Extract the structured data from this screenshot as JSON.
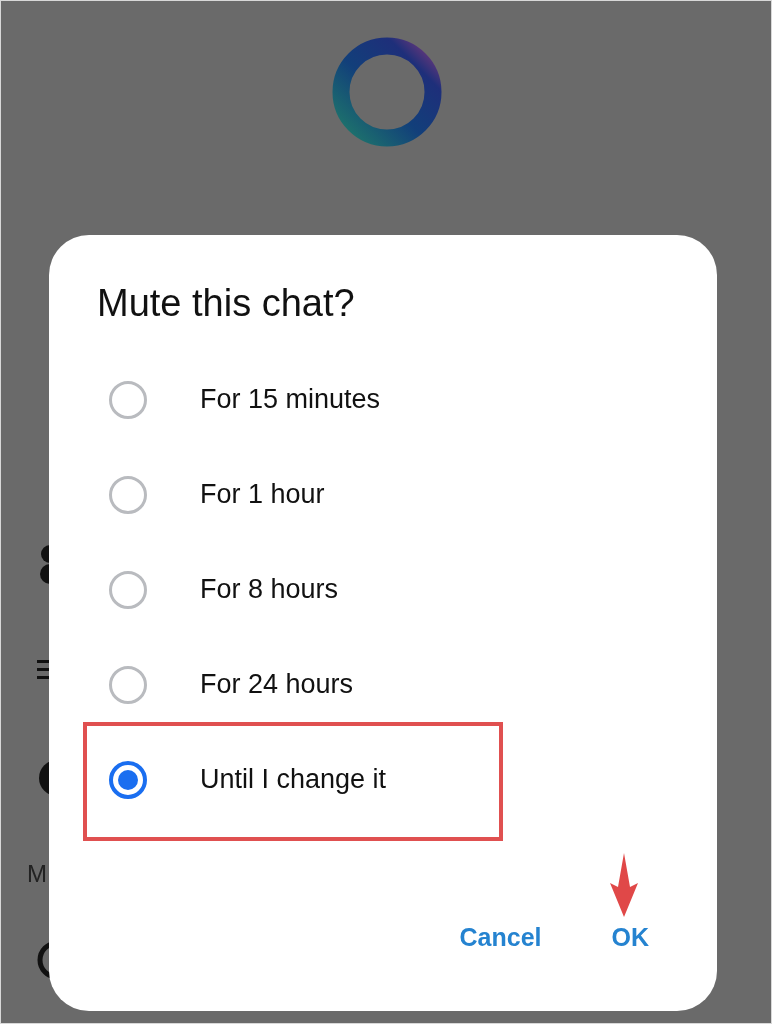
{
  "background": {
    "side_label": "M"
  },
  "dialog": {
    "title": "Mute this chat?",
    "options": [
      {
        "label": "For 15 minutes",
        "selected": false
      },
      {
        "label": "For 1 hour",
        "selected": false
      },
      {
        "label": "For 8 hours",
        "selected": false
      },
      {
        "label": "For 24 hours",
        "selected": false
      },
      {
        "label": "Until I change it",
        "selected": true
      }
    ],
    "buttons": [
      "Cancel",
      "OK"
    ]
  }
}
